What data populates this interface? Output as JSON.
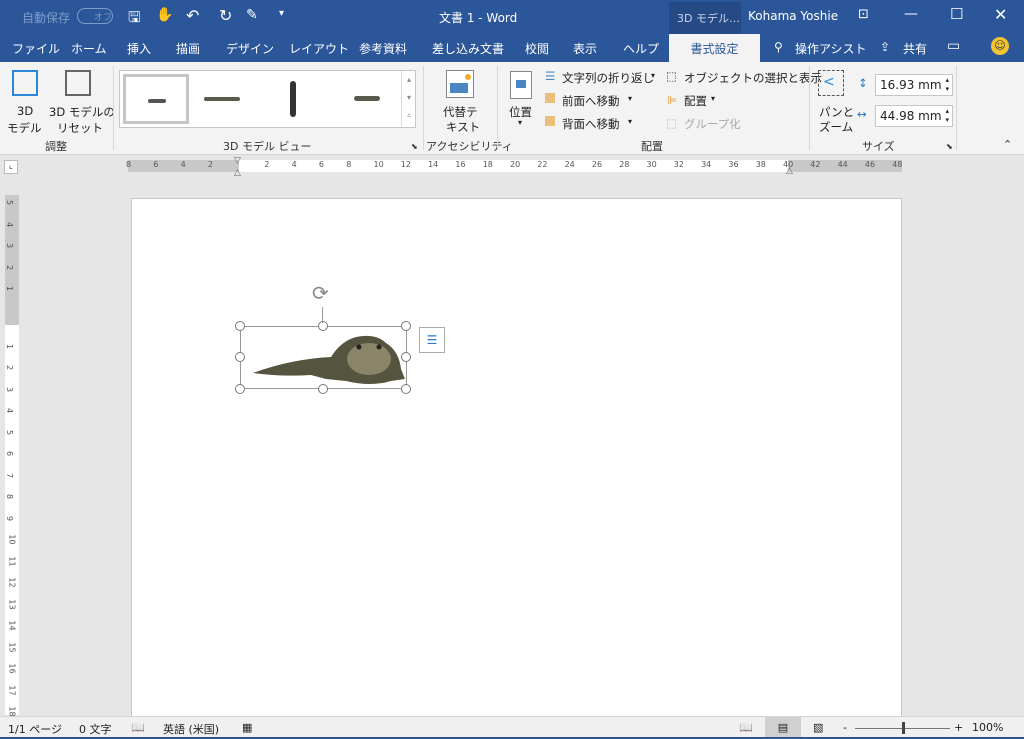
{
  "titlebar": {
    "autosave": "自動保存",
    "autosave_state": "オフ",
    "doc_title": "文書 1  -  Word",
    "context_tab": "3D モデル…",
    "user": "Kohama Yoshie"
  },
  "tabs": [
    "ファイル",
    "ホーム",
    "挿入",
    "描画",
    "デザイン",
    "レイアウト",
    "参考資料",
    "差し込み文書",
    "校閲",
    "表示",
    "ヘルプ",
    "書式設定"
  ],
  "tell_me": "操作アシスト",
  "share": "共有",
  "ribbon": {
    "adjust": {
      "model_3d": "3D",
      "model_3d_2": "モデル",
      "reset": "3D モデルの",
      "reset_2": "リセット",
      "group": "調整"
    },
    "views": {
      "group": "3D モデル ビュー"
    },
    "accessibility": {
      "alt_text": "代替テ",
      "alt_text_2": "キスト",
      "group": "アクセシビリティ"
    },
    "arrange": {
      "position": "位置",
      "wrap": "文字列の折り返し",
      "forward": "前面へ移動",
      "backward": "背面へ移動",
      "selection_pane": "オブジェクトの選択と表示",
      "align": "配置",
      "group_btn": "グループ化",
      "group": "配置"
    },
    "size": {
      "pan_zoom": "パンと",
      "pan_zoom_2": "ズーム",
      "height": "16.93 mm",
      "width": "44.98 mm",
      "group": "サイズ"
    }
  },
  "ruler": {
    "h": [
      "8",
      "6",
      "4",
      "2",
      "2",
      "4",
      "6",
      "8",
      "10",
      "12",
      "14",
      "16",
      "18",
      "20",
      "22",
      "24",
      "26",
      "28",
      "30",
      "32",
      "34",
      "36",
      "38",
      "40",
      "42",
      "44",
      "46",
      "48"
    ],
    "v": [
      "5",
      "4",
      "3",
      "2",
      "1",
      "1",
      "2",
      "3",
      "4",
      "5",
      "6",
      "7",
      "8",
      "9",
      "10",
      "11",
      "12",
      "13",
      "14",
      "15",
      "16",
      "17",
      "18"
    ]
  },
  "status": {
    "page": "1/1 ページ",
    "words": "0 文字",
    "language": "英語 (米国)",
    "zoom": "100%",
    "zoom_level": 100
  }
}
